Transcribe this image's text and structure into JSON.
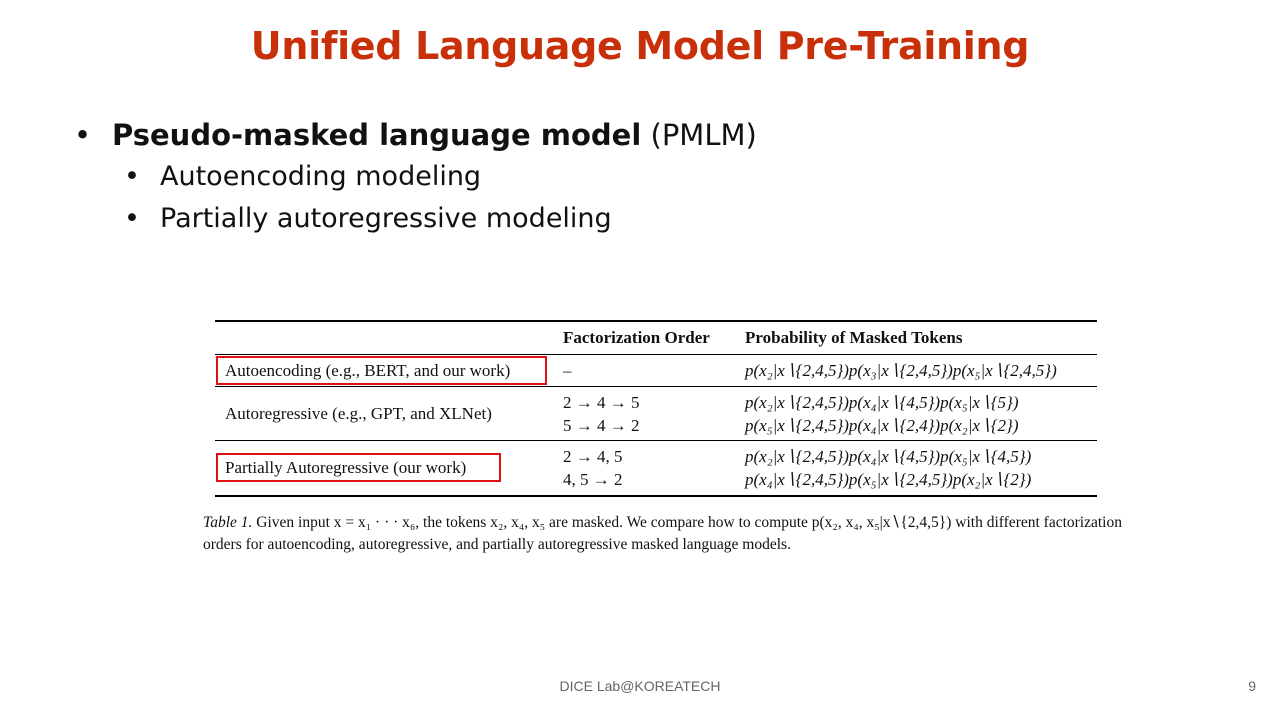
{
  "slide": {
    "title": "Unified Language Model Pre-Training",
    "footer": "DICE Lab@KOREATECH",
    "page_number": "9"
  },
  "bullets": {
    "main_bold": "Pseudo-masked language model",
    "main_rest": "(PMLM)",
    "sub": [
      "Autoencoding modeling",
      "Partially autoregressive modeling"
    ]
  },
  "table": {
    "headers": [
      "",
      "Factorization Order",
      "Probability of Masked Tokens"
    ],
    "rows": [
      {
        "name": "Autoencoding (e.g., BERT, and our work)",
        "orders": [
          "–"
        ],
        "probs": [
          "p(x₂|x∖{2,4,5})p(x₃|x∖{2,4,5})p(x₅|x∖{2,4,5})"
        ],
        "highlighted": true
      },
      {
        "name": "Autoregressive (e.g., GPT, and XLNet)",
        "orders": [
          "2 → 4 → 5",
          "5 → 4 → 2"
        ],
        "probs": [
          "p(x₂|x∖{2,4,5})p(x₄|x∖{4,5})p(x₅|x∖{5})",
          "p(x₅|x∖{2,4,5})p(x₄|x∖{2,4})p(x₂|x∖{2})"
        ],
        "highlighted": false
      },
      {
        "name": "Partially Autoregressive (our work)",
        "orders": [
          "2 → 4, 5",
          "4, 5 → 2"
        ],
        "probs": [
          "p(x₂|x∖{2,4,5})p(x₄|x∖{4,5})p(x₅|x∖{4,5})",
          "p(x₄|x∖{2,4,5})p(x₅|x∖{2,4,5})p(x₂|x∖{2})"
        ],
        "highlighted": true
      }
    ],
    "highlight_color": "#e01010"
  },
  "caption": {
    "label": "Table 1.",
    "text": "Given input x = x₁ · · · x₆, the tokens x₂, x₄, x₅ are masked. We compare how to compute p(x₂, x₄, x₅|x∖{2,4,5}) with different factorization orders for autoencoding, autoregressive, and partially autoregressive masked language models."
  },
  "colors": {
    "title": "#c8300a",
    "text": "#111111",
    "footer": "#666666"
  }
}
